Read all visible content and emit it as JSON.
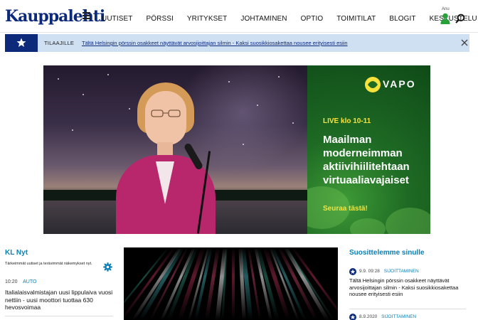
{
  "header": {
    "logo": "Kauppalehti",
    "nav": [
      "UUTISET",
      "PÖRSSI",
      "YRITYKSET",
      "JOHTAMINEN",
      "OPTIO",
      "TOIMITILAT",
      "BLOGIT",
      "KESKUSTELU"
    ],
    "user_name": "Anu",
    "icons": [
      "menu-icon",
      "user-icon",
      "search-icon"
    ]
  },
  "banner": {
    "label": "TILAAJILLE",
    "link_text": "Tältä Helsingin pörssin osakkeet näyttävät arvosijoittajan silmin - Kaksi suosikkiosakettaa nousee erityisesti esiin",
    "icons": [
      "star-icon",
      "close-icon"
    ]
  },
  "ad": {
    "brand": "VAPO",
    "live": "LIVE klo 10-11",
    "headline": "Maailman moderneimman aktiivihiilitehtaan virtuaaliavajaiset",
    "cta": "Seuraa tästä!"
  },
  "kl_nyt": {
    "title": "KL Nyt",
    "description": "Tärkeimmät uutiset ja terävimmät näkemykset nyt.",
    "items": [
      {
        "time": "10:20",
        "category": "AUTO",
        "headline": "Italialaisvalmistajan uusi lippulaiva vuosi nettiin - uusi moottori tuottaa 630 hevosvoimaa"
      }
    ]
  },
  "recommend": {
    "title": "Suosittelemme sinulle",
    "items": [
      {
        "date": "9.9.",
        "time": "09:28",
        "category": "SIJOITTAMINEN",
        "headline": "Tältä Helsingin pörssin osakkeet näyttävät arvosijoittajan silmin - Kaksi suosikkiosakettaa nousee erityisesti esiin"
      },
      {
        "date": "8.9.2020",
        "time": "",
        "category": "SIJOITTAMINEN",
        "headline": ""
      }
    ]
  },
  "colors": {
    "brand": "#0d2a7a",
    "accent": "#0d7fb3",
    "banner_bg": "#cfe0f3",
    "ad_green": "#1f6b23",
    "ad_yellow": "#f6e23a"
  }
}
